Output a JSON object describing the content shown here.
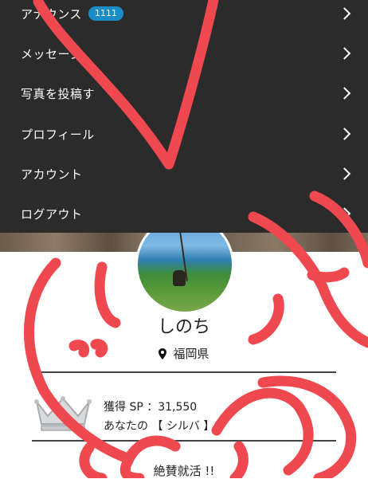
{
  "menu": {
    "items": [
      {
        "label": "アナウンス",
        "badge": "1111"
      },
      {
        "label": "メッセージ"
      },
      {
        "label": "写真を投稿す"
      },
      {
        "label": "プロフィール"
      },
      {
        "label": "アカウント"
      },
      {
        "label": "ログアウト"
      }
    ]
  },
  "profile": {
    "name": "しのち",
    "location": "福岡県"
  },
  "status": {
    "sp_line": "獲得 SP ：31,550",
    "rank_line": "あなたの    【 シルバ     】"
  },
  "footer": {
    "text": "絶賛就活   !!"
  },
  "colors": {
    "menu_bg": "#2b2b2b",
    "badge": "#1a8cc7",
    "scribble": "#f0484f"
  }
}
